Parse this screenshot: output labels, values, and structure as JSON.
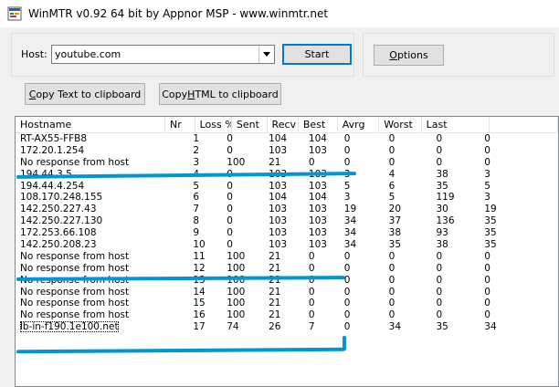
{
  "window": {
    "title": "WinMTR v0.92 64 bit by Appnor MSP - www.winmtr.net",
    "icon": "winmtr-app-icon"
  },
  "host": {
    "label": "Host:",
    "value": "youtube.com"
  },
  "buttons": {
    "start": "Start",
    "options_accel": "O",
    "options_rest": "ptions",
    "copy_text_accel": "C",
    "copy_text_rest": "opy Text to clipboard",
    "copy_html_pre": "Copy ",
    "copy_html_accel": "H",
    "copy_html_rest": "TML to clipboard"
  },
  "table": {
    "columns": [
      "Hostname",
      "Nr",
      "Loss %",
      "Sent",
      "Recv",
      "Best",
      "Avrg",
      "Worst",
      "Last"
    ],
    "rows": [
      [
        "RT-AX55-FFB8",
        "1",
        "0",
        "104",
        "104",
        "0",
        "0",
        "0",
        "0"
      ],
      [
        "172.20.1.254",
        "2",
        "0",
        "103",
        "103",
        "0",
        "0",
        "0",
        "0"
      ],
      [
        "No response from host",
        "3",
        "100",
        "21",
        "0",
        "0",
        "0",
        "0",
        "0"
      ],
      [
        "194.44.3.5",
        "4",
        "0",
        "103",
        "103",
        "3",
        "4",
        "38",
        "3"
      ],
      [
        "194.44.4.254",
        "5",
        "0",
        "103",
        "103",
        "5",
        "6",
        "35",
        "5"
      ],
      [
        "108.170.248.155",
        "6",
        "0",
        "104",
        "104",
        "3",
        "5",
        "119",
        "3"
      ],
      [
        "142.250.227.43",
        "7",
        "0",
        "103",
        "103",
        "19",
        "20",
        "30",
        "19"
      ],
      [
        "142.250.227.130",
        "8",
        "0",
        "103",
        "103",
        "34",
        "37",
        "136",
        "35"
      ],
      [
        "172.253.66.108",
        "9",
        "0",
        "103",
        "103",
        "34",
        "38",
        "93",
        "35"
      ],
      [
        "142.250.208.23",
        "10",
        "0",
        "103",
        "103",
        "34",
        "35",
        "38",
        "35"
      ],
      [
        "No response from host",
        "11",
        "100",
        "21",
        "0",
        "0",
        "0",
        "0",
        "0"
      ],
      [
        "No response from host",
        "12",
        "100",
        "21",
        "0",
        "0",
        "0",
        "0",
        "0"
      ],
      [
        "No response from host",
        "13",
        "100",
        "21",
        "0",
        "0",
        "0",
        "0",
        "0"
      ],
      [
        "No response from host",
        "14",
        "100",
        "21",
        "0",
        "0",
        "0",
        "0",
        "0"
      ],
      [
        "No response from host",
        "15",
        "100",
        "21",
        "0",
        "0",
        "0",
        "0",
        "0"
      ],
      [
        "No response from host",
        "16",
        "100",
        "21",
        "0",
        "0",
        "0",
        "0",
        "0"
      ],
      [
        "lb-in-f190.1e100.net",
        "17",
        "74",
        "26",
        "7",
        "0",
        "34",
        "35",
        "34"
      ]
    ]
  },
  "colors": {
    "annotation": "#0096d6",
    "focus_border": "#0078d7"
  }
}
